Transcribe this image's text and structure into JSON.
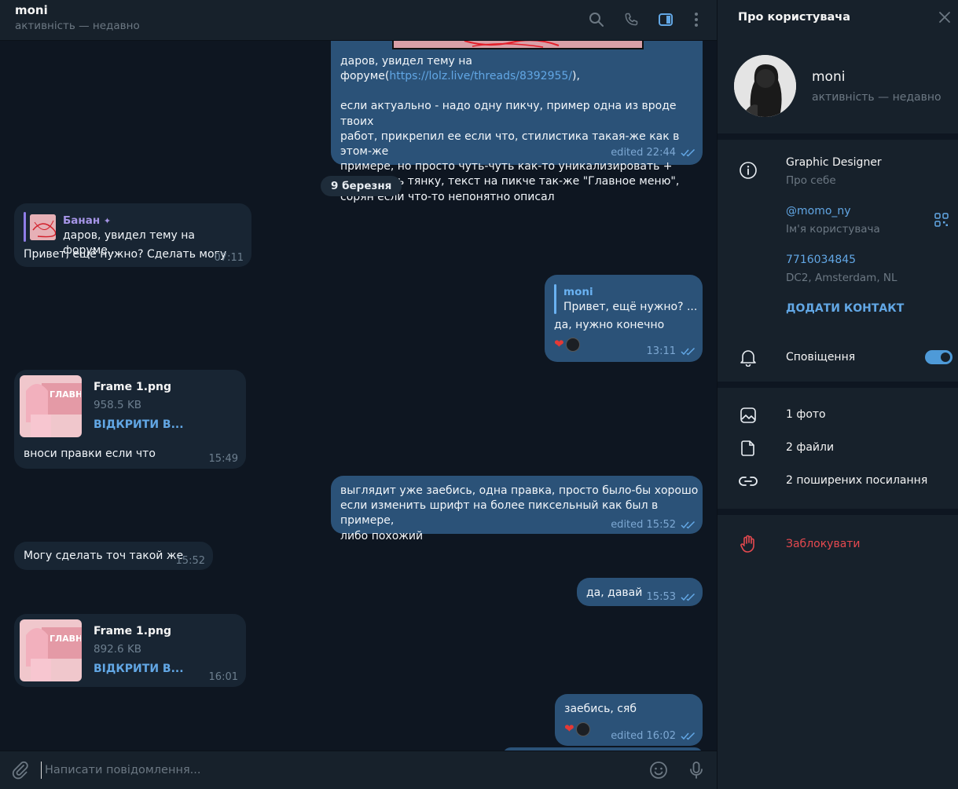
{
  "header": {
    "title": "moni",
    "status": "активність — недавно"
  },
  "messages": {
    "m1": {
      "lines": [
        "даров, увидел тему на форуме(",
        "https://lolz.live/threads/8392955/",
        "),",
        "",
        "если актуально - надо одну пикчу, пример одна из вроде твоих",
        "работ, прикрепил ее если что, стилистика такая-же как в этом-же",
        "примере, но просто чуть-чуть как-то уникализировать +",
        "подменить тянку, текст на пикче так-же \"Главное меню\",",
        "сорян если что-то непонятно описал"
      ],
      "meta": "edited 22:44"
    },
    "date_separator": "9 березня",
    "m2": {
      "reply_name": "Банан",
      "reply_text": "даров, увидел тему на форуме...",
      "text": "Привет, ещё нужно? Сделать могу",
      "time": "07:11"
    },
    "m3": {
      "reply_name": "moni",
      "reply_text": "Привет, ещё нужно? ...",
      "text": "да, нужно конечно",
      "time": "13:11"
    },
    "m4": {
      "file_name": "Frame 1.png",
      "file_size": "958.5 KB",
      "open_label": "ВІДКРИТИ В...",
      "caption": "вноси правки если  что",
      "time": "15:49",
      "thumb_text": "ГЛАВН МЕ"
    },
    "m5": {
      "lines": [
        "выглядит уже заебись, одна правка, просто было-бы хорошо",
        "если изменить шрифт на более пиксельный как был в примере,",
        "либо похожий"
      ],
      "meta": "edited 15:52"
    },
    "m6": {
      "text": "Могу сделать точ такой же",
      "time": "15:52"
    },
    "m7": {
      "text": "да, давай",
      "time": "15:53"
    },
    "m8": {
      "file_name": "Frame 1.png",
      "file_size": "892.6 KB",
      "open_label": "ВІДКРИТИ В...",
      "time": "16:01",
      "thumb_text": "ГЛАВН МЕ"
    },
    "m9": {
      "text": "заебись, сяб",
      "meta": "edited 16:02"
    }
  },
  "composer": {
    "placeholder": "Написати повідомлення..."
  },
  "panel": {
    "title": "Про користувача",
    "name": "moni",
    "status": "активність — недавно",
    "bio": "Graphic Designer",
    "bio_label": "Про себе",
    "username": "@momo_ny",
    "username_label": "Ім'я користувача",
    "phone": "7716034845",
    "dc": "DC2, Amsterdam, NL",
    "add_contact": "ДОДАТИ КОНТАКТ",
    "notifications": "Сповіщення",
    "notifications_on": true,
    "photos": "1 фото",
    "files": "2 файли",
    "links": "2 поширених посилання",
    "block": "Заблокувати"
  },
  "colors": {
    "accent": "#62a7e5",
    "bubble_out": "#2b5278",
    "bubble_in": "#182533",
    "danger": "#e5494f"
  },
  "icons": [
    "search-icon",
    "phone-icon",
    "sidebar-toggle-icon",
    "more-vertical-icon",
    "close-icon",
    "info-icon",
    "qr-code-icon",
    "bell-icon",
    "image-icon",
    "file-icon",
    "link-icon",
    "block-hand-icon",
    "paperclip-icon",
    "emoji-icon",
    "microphone-icon"
  ]
}
